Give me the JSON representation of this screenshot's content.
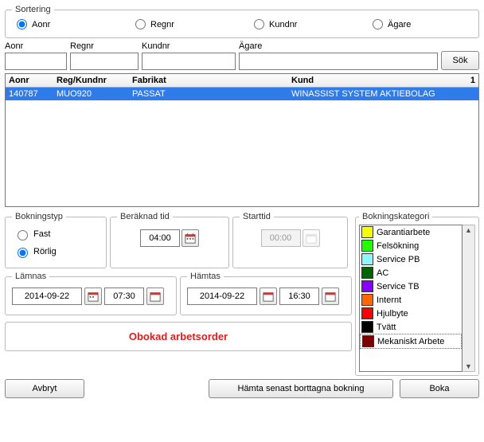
{
  "sortering": {
    "legend": "Sortering",
    "options": {
      "aonr": "Aonr",
      "regnr": "Regnr",
      "kundnr": "Kundnr",
      "agare": "Ägare"
    },
    "selected": "aonr"
  },
  "search": {
    "labels": {
      "aonr": "Aonr",
      "regnr": "Regnr",
      "kundnr": "Kundnr",
      "agare": "Ägare"
    },
    "values": {
      "aonr": "",
      "regnr": "",
      "kundnr": "",
      "agare": ""
    },
    "button": "Sök"
  },
  "grid": {
    "headers": {
      "aonr": "Aonr",
      "reg": "Reg/Kundnr",
      "fabrikat": "Fabrikat",
      "kund": "Kund"
    },
    "count": "1",
    "rows": [
      {
        "aonr": "140787",
        "reg": "MUO920",
        "fabrikat": "PASSAT",
        "kund": "WINASSIST SYSTEM AKTIEBOLAG"
      }
    ]
  },
  "bokningstyp": {
    "legend": "Bokningstyp",
    "options": {
      "fast": "Fast",
      "rorlig": "Rörlig"
    },
    "selected": "rorlig"
  },
  "beraknad": {
    "legend": "Beräknad tid",
    "value": "04:00"
  },
  "starttid": {
    "legend": "Starttid",
    "value": "00:00"
  },
  "lamnas": {
    "legend": "Lämnas",
    "date": "2014-09-22",
    "time": "07:30"
  },
  "hamtas": {
    "legend": "Hämtas",
    "date": "2014-09-22",
    "time": "16:30"
  },
  "kategori": {
    "legend": "Bokningskategori",
    "items": [
      {
        "label": "Garantiarbete",
        "color": "#f4ff00"
      },
      {
        "label": "Felsökning",
        "color": "#22ff00"
      },
      {
        "label": "Service PB",
        "color": "#8ff6ff"
      },
      {
        "label": "AC",
        "color": "#006300"
      },
      {
        "label": "Service TB",
        "color": "#8800ff"
      },
      {
        "label": "Internt",
        "color": "#ff6600"
      },
      {
        "label": "Hjulbyte",
        "color": "#ff0000"
      },
      {
        "label": "Tvätt",
        "color": "#000000"
      },
      {
        "label": "Mekaniskt Arbete",
        "color": "#7d0000",
        "selected": true
      }
    ]
  },
  "status": "Obokad arbetsorder",
  "buttons": {
    "avbryt": "Avbryt",
    "hamta": "Hämta senast borttagna bokning",
    "boka": "Boka"
  }
}
